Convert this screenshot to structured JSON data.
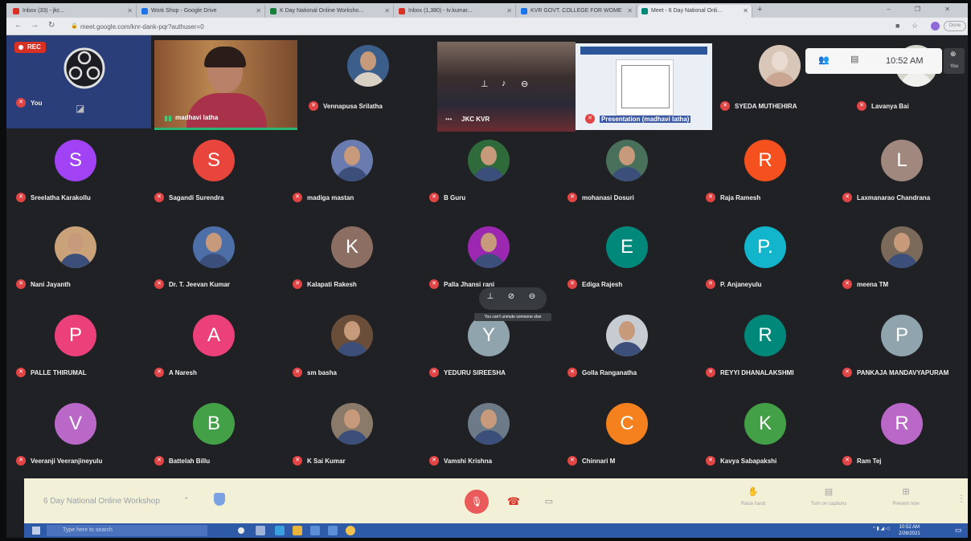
{
  "browser": {
    "tabs": [
      {
        "title": "Inbox (33) - jkc...",
        "color": "#d93025"
      },
      {
        "title": "Work Shop - Google Drive",
        "color": "#1a73e8"
      },
      {
        "title": "K Day National Online Worksho...",
        "color": "#188038"
      },
      {
        "title": "Inbox (1,380) - tv.kumar...",
        "color": "#d93025"
      },
      {
        "title": "KVR GOVT. COLLEGE FOR WOME",
        "color": "#1a73e8"
      },
      {
        "title": "Meet - 6 Day National Onli...",
        "color": "#00897b"
      }
    ],
    "url": "meet.google.com/knr-dank-pqr?authuser=0",
    "profile_label": "Done"
  },
  "meet": {
    "rec_label": "REC",
    "clock": "10:52 AM",
    "self_tile_label": "You",
    "hover_tooltip": "You can't unmute someone else",
    "meeting_title": "6 Day National Online Workshop",
    "bottom_actions": [
      {
        "label": "Raise hand",
        "icon": "hand-icon"
      },
      {
        "label": "Turn on captions",
        "icon": "captions-icon"
      },
      {
        "label": "Present now",
        "icon": "present-icon"
      }
    ],
    "top_tiles": [
      {
        "name": "You"
      },
      {
        "name": "madhavi latha"
      },
      {
        "name": "Vennapusa Srilatha"
      },
      {
        "name": "JKC KVR"
      },
      {
        "name": "Presentation (madhavi latha)"
      },
      {
        "name": "SYEDA MUTHEHIRA"
      },
      {
        "name": "Lavanya Bai"
      }
    ],
    "participants": [
      {
        "name": "Sreelatha Karakollu",
        "initial": "S",
        "color": "#a142f4"
      },
      {
        "name": "Sagandi Surendra",
        "initial": "S",
        "color": "#e8453c"
      },
      {
        "name": "madiga mastan",
        "initial": "",
        "color": "#6a7bb0"
      },
      {
        "name": "B Guru",
        "initial": "",
        "color": "#2f6b3a"
      },
      {
        "name": "mohanasi Dosuri",
        "initial": "",
        "color": "#48705a"
      },
      {
        "name": "Raja Ramesh",
        "initial": "R",
        "color": "#f4511e"
      },
      {
        "name": "Laxmanarao Chandrana",
        "initial": "L",
        "color": "#a1887f"
      },
      {
        "name": "Nani Jayanth",
        "initial": "",
        "color": "#c9a27a"
      },
      {
        "name": "Dr. T. Jeevan Kumar",
        "initial": "",
        "color": "#4d6fa8"
      },
      {
        "name": "Kalapati Rakesh",
        "initial": "K",
        "color": "#8d6e63"
      },
      {
        "name": "Palla Jhansi rani",
        "initial": "",
        "color": "#9c27b0"
      },
      {
        "name": "Ediga Rajesh",
        "initial": "E",
        "color": "#00897b"
      },
      {
        "name": "P. Anjaneyulu",
        "initial": "P.",
        "color": "#12b5cb"
      },
      {
        "name": "meena TM",
        "initial": "",
        "color": "#7b6a5a"
      },
      {
        "name": "PALLE THIRUMAL",
        "initial": "P",
        "color": "#ec407a"
      },
      {
        "name": "A Naresh",
        "initial": "A",
        "color": "#ec407a"
      },
      {
        "name": "sm basha",
        "initial": "",
        "color": "#6a4e3a"
      },
      {
        "name": "YEDURU SIREESHA",
        "initial": "Y",
        "color": "#90a4ae"
      },
      {
        "name": "Golla Ranganatha",
        "initial": "",
        "color": "#c7ccd3"
      },
      {
        "name": "REYYI DHANALAKSHMI",
        "initial": "R",
        "color": "#00897b"
      },
      {
        "name": "PANKAJA MANDAVYAPURAM",
        "initial": "P",
        "color": "#90a4ae"
      },
      {
        "name": "Veeranji Veeranjineyulu",
        "initial": "V",
        "color": "#ba68c8"
      },
      {
        "name": "Battelah Billu",
        "initial": "B",
        "color": "#43a047"
      },
      {
        "name": "K Sai Kumar",
        "initial": "",
        "color": "#8a7a6a"
      },
      {
        "name": "Vamshi Krishna",
        "initial": "",
        "color": "#6d7a88"
      },
      {
        "name": "Chinnari M",
        "initial": "C",
        "color": "#f4811e"
      },
      {
        "name": "Kavya Sabapakshi",
        "initial": "K",
        "color": "#43a047"
      },
      {
        "name": "Ram Tej",
        "initial": "R",
        "color": "#ba68c8"
      }
    ]
  },
  "taskbar": {
    "search_placeholder": "Type here to search",
    "time": "10:52 AM",
    "date": "2/26/2021"
  }
}
